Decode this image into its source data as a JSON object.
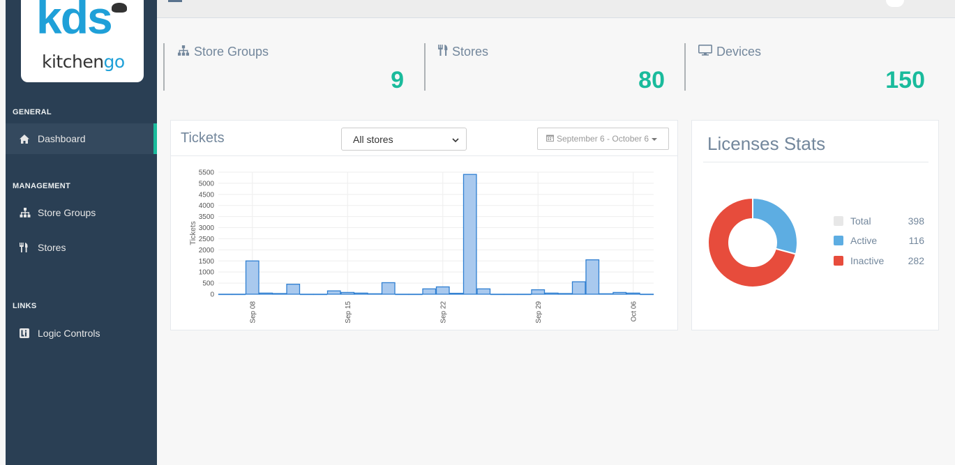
{
  "logo": {
    "main": "kds",
    "sub_prefix": "kitchen",
    "sub_suffix": "go"
  },
  "sidebar": {
    "sections": [
      {
        "title": "GENERAL",
        "items": [
          {
            "label": "Dashboard",
            "icon": "home-icon",
            "active": true
          }
        ]
      },
      {
        "title": "MANAGEMENT",
        "items": [
          {
            "label": "Store Groups",
            "icon": "sitemap-icon"
          },
          {
            "label": "Stores",
            "icon": "cutlery-icon"
          }
        ]
      },
      {
        "title": "LINKS",
        "items": [
          {
            "label": "Logic Controls",
            "icon": "logic-controls-icon"
          }
        ]
      }
    ]
  },
  "stats": [
    {
      "label": "Store Groups",
      "count": "9",
      "icon": "sitemap-icon"
    },
    {
      "label": "Stores",
      "count": "80",
      "icon": "cutlery-icon"
    },
    {
      "label": "Devices",
      "count": "150",
      "icon": "desktop-icon"
    }
  ],
  "tickets": {
    "title": "Tickets",
    "store_filter": "All stores",
    "date_range": "September 6 - October 6"
  },
  "licenses": {
    "title": "Licenses Stats",
    "legend": [
      {
        "label": "Total",
        "value": "398",
        "color": "#e7e7e7"
      },
      {
        "label": "Active",
        "value": "116",
        "color": "#5dade2"
      },
      {
        "label": "Inactive",
        "value": "282",
        "color": "#e74c3c"
      }
    ]
  },
  "colors": {
    "accent": "#1abb9c",
    "sidebar": "#2a3f54",
    "bar_fill": "#a9c9ee",
    "bar_stroke": "#2f7fd1"
  },
  "chart_data": [
    {
      "type": "bar",
      "ylabel": "Tickets",
      "yticks": [
        0,
        500,
        1000,
        1500,
        2000,
        2500,
        3000,
        3500,
        4000,
        4500,
        5000,
        5500
      ],
      "ylim": [
        0,
        5500
      ],
      "x_ticks": [
        "Sep 08",
        "Sep 15",
        "Sep 22",
        "Sep 29",
        "Oct 06"
      ],
      "grid": true,
      "legend": "none",
      "categories": [
        "Sep 06",
        "Sep 07",
        "Sep 08",
        "Sep 09",
        "Sep 10",
        "Sep 11",
        "Sep 12",
        "Sep 13",
        "Sep 14",
        "Sep 15",
        "Sep 16",
        "Sep 17",
        "Sep 18",
        "Sep 19",
        "Sep 20",
        "Sep 21",
        "Sep 22",
        "Sep 23",
        "Sep 24",
        "Sep 25",
        "Sep 26",
        "Sep 27",
        "Sep 28",
        "Sep 29",
        "Sep 30",
        "Oct 01",
        "Oct 02",
        "Oct 03",
        "Oct 04",
        "Oct 05",
        "Oct 06"
      ],
      "values": [
        0,
        0,
        1500,
        50,
        30,
        450,
        0,
        0,
        150,
        80,
        50,
        20,
        520,
        0,
        0,
        240,
        330,
        40,
        5400,
        240,
        0,
        0,
        0,
        200,
        50,
        30,
        560,
        1550,
        20,
        80,
        50,
        0
      ]
    },
    {
      "type": "pie",
      "categories": [
        "Active",
        "Inactive"
      ],
      "values": [
        116,
        282
      ],
      "total": 398
    }
  ]
}
